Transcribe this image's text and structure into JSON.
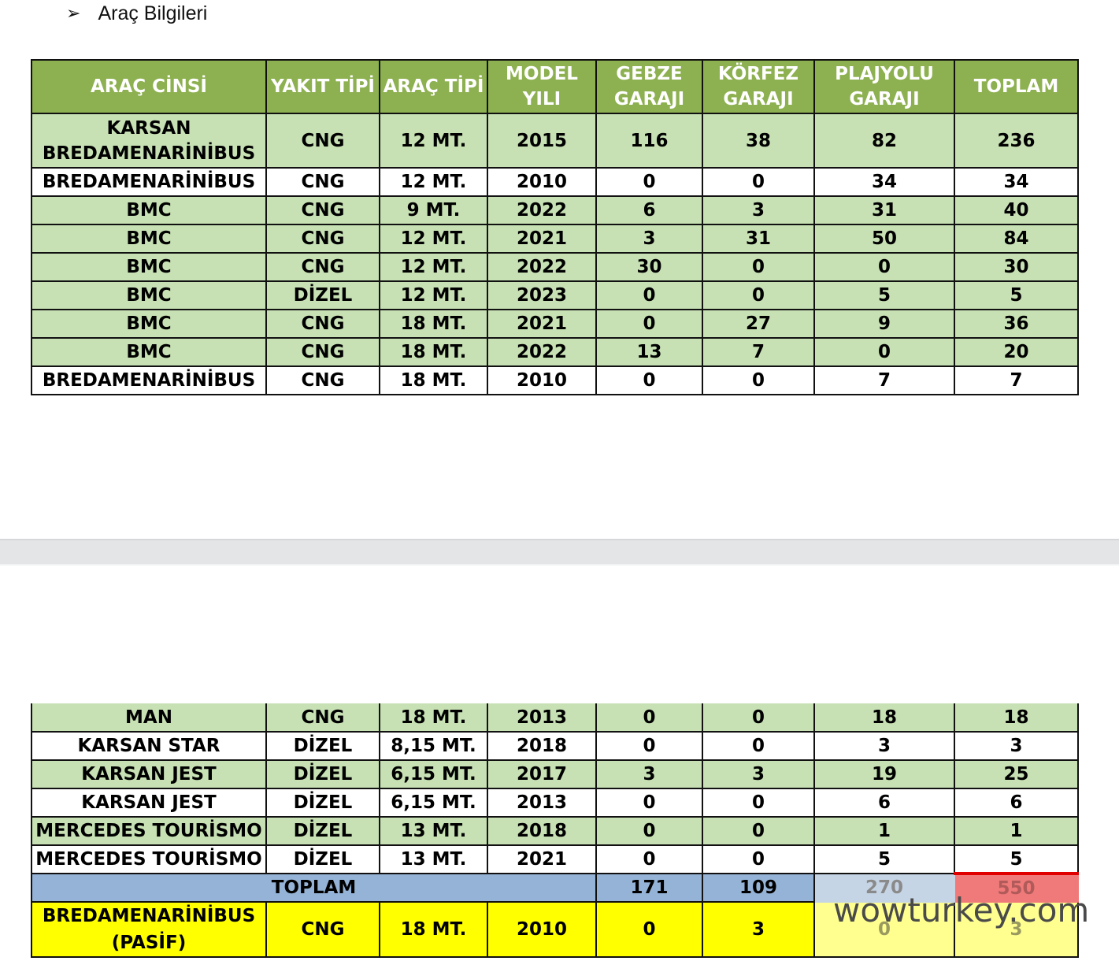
{
  "heading": {
    "bullet_icon": "arrow-bullet-icon",
    "bullet_glyph": "➢",
    "text": "Araç Bilgileri"
  },
  "table": {
    "headers": [
      "ARAÇ CİNSİ",
      "YAKIT TİPİ",
      "ARAÇ TİPİ",
      "MODEL YILI",
      "GEBZE GARAJI",
      "KÖRFEZ GARAJI",
      "PLAJYOLU GARAJI",
      "TOPLAM"
    ],
    "upper_rows": [
      [
        "KARSAN BREDAMENARİNİBUS",
        "CNG",
        "12 MT.",
        "2015",
        "116",
        "38",
        "82",
        "236"
      ],
      [
        "BREDAMENARİNİBUS",
        "CNG",
        "12 MT.",
        "2010",
        "0",
        "0",
        "34",
        "34"
      ],
      [
        "BMC",
        "CNG",
        "9 MT.",
        "2022",
        "6",
        "3",
        "31",
        "40"
      ],
      [
        "BMC",
        "CNG",
        "12 MT.",
        "2021",
        "3",
        "31",
        "50",
        "84"
      ],
      [
        "BMC",
        "CNG",
        "12 MT.",
        "2022",
        "30",
        "0",
        "0",
        "30"
      ],
      [
        "BMC",
        "DİZEL",
        "12 MT.",
        "2023",
        "0",
        "0",
        "5",
        "5"
      ],
      [
        "BMC",
        "CNG",
        "18 MT.",
        "2021",
        "0",
        "27",
        "9",
        "36"
      ],
      [
        "BMC",
        "CNG",
        "18 MT.",
        "2022",
        "13",
        "7",
        "0",
        "20"
      ],
      [
        "BREDAMENARİNİBUS",
        "CNG",
        "18 MT.",
        "2010",
        "0",
        "0",
        "7",
        "7"
      ]
    ],
    "lower_rows": [
      [
        "MAN",
        "CNG",
        "18 MT.",
        "2013",
        "0",
        "0",
        "18",
        "18"
      ],
      [
        "KARSAN STAR",
        "DİZEL",
        "8,15 MT.",
        "2018",
        "0",
        "0",
        "3",
        "3"
      ],
      [
        "KARSAN JEST",
        "DİZEL",
        "6,15 MT.",
        "2017",
        "3",
        "3",
        "19",
        "25"
      ],
      [
        "KARSAN JEST",
        "DİZEL",
        "6,15 MT.",
        "2013",
        "0",
        "0",
        "6",
        "6"
      ],
      [
        "MERCEDES TOURİSMO",
        "DİZEL",
        "13 MT.",
        "2018",
        "0",
        "0",
        "1",
        "1"
      ],
      [
        "MERCEDES TOURİSMO",
        "DİZEL",
        "13 MT.",
        "2021",
        "0",
        "0",
        "5",
        "5"
      ]
    ],
    "total_row": {
      "label": "TOPLAM",
      "gebze": "171",
      "korfez": "109",
      "plajyolu": "270",
      "toplam": "550"
    },
    "passive_row": [
      "BREDAMENARİNİBUS (PASİF)",
      "CNG",
      "18 MT.",
      "2010",
      "0",
      "3",
      "0",
      "3"
    ]
  },
  "watermark": "wowturkey.com",
  "colors": {
    "header_green": "#8db050",
    "row_green": "#c7e1b4",
    "total_blue": "#95b3d6",
    "passive_yellow": "#ffff00",
    "total_red": "#f07a7a"
  }
}
